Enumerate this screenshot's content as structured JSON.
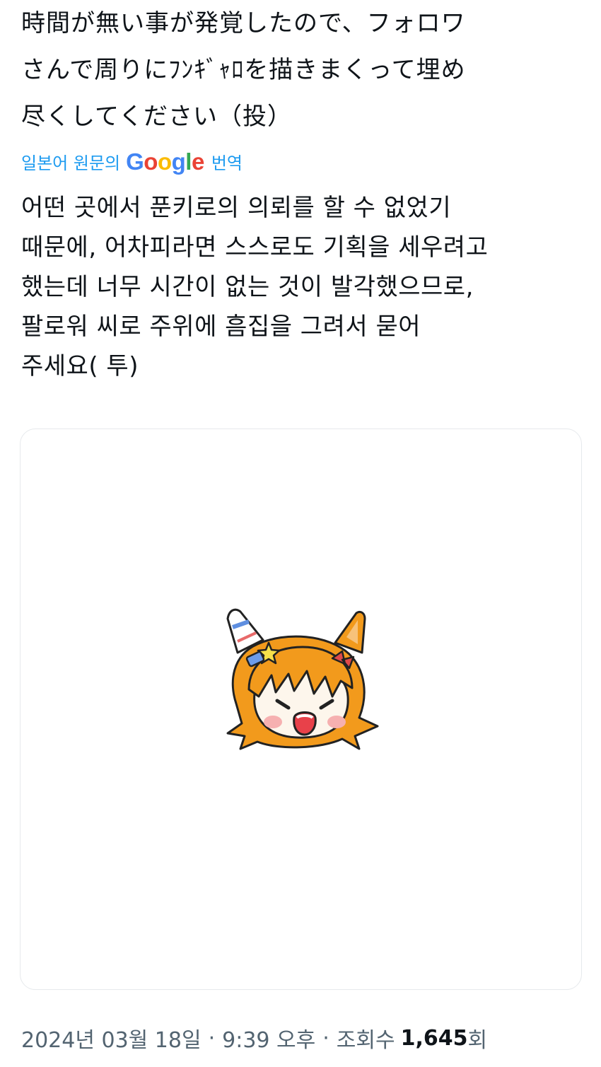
{
  "tweet": {
    "original_lines": [
      "時間が無い事が発覚したので、フォロワ",
      "さんで周りにﾌﾝｷﾞｬﾛを描きまくって埋め",
      "尽くしてください（投）"
    ],
    "translate": {
      "prefix": "일본어 원문의",
      "google_letters": [
        "G",
        "o",
        "o",
        "g",
        "l",
        "e"
      ],
      "google_colors": [
        "#4285F4",
        "#EA4335",
        "#FBBC05",
        "#4285F4",
        "#34A853",
        "#EA4335"
      ],
      "suffix": "번역"
    },
    "translated_lines": [
      "어떤 곳에서 푼키로의 의뢰를 할 수 없었기",
      "때문에, 어차피라면 스스로도 기획을 세우려고",
      "했는데 너무 시간이 없는 것이 발각했으므로,",
      "팔로워 씨로 주위에 흠집을 그려서 묻어",
      "주세요( 투)"
    ],
    "meta": {
      "date": "2024년 03월 18일",
      "separator": "·",
      "time": "9:39 오후",
      "views_label": "조회수",
      "views_count": "1,645",
      "views_unit": "회"
    },
    "colors": {
      "text": "#0f1419",
      "link": "#1d9bf0",
      "muted": "#536471",
      "hair": "#f29a1c"
    }
  }
}
